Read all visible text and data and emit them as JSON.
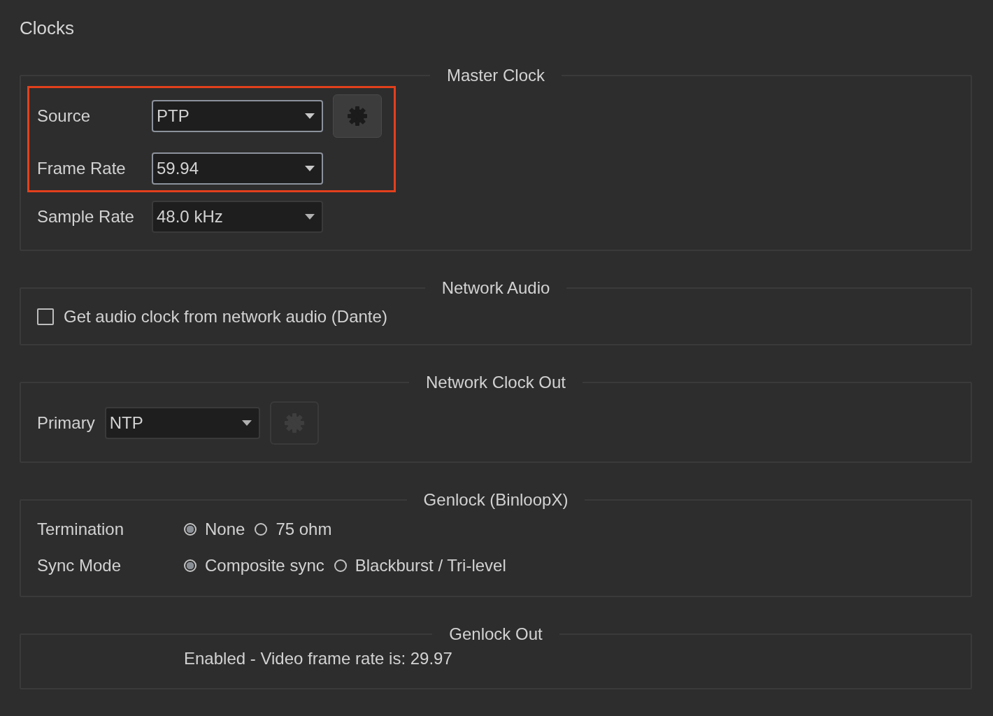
{
  "title": "Clocks",
  "sections": [
    {
      "legend": "Master Clock",
      "kind": "dropdowns",
      "rows": [
        {
          "label": "Source",
          "value": "PTP",
          "highlighted": true,
          "gear": {
            "disabled": false
          }
        },
        {
          "label": "Frame Rate",
          "value": "59.94",
          "highlighted": true
        },
        {
          "label": "Sample Rate",
          "value": "48.0 kHz",
          "highlighted": false
        }
      ]
    },
    {
      "legend": "Network Audio",
      "kind": "checkbox",
      "label": "Get audio clock from network audio (Dante)",
      "checked": false
    },
    {
      "legend": "Network Clock Out",
      "kind": "dropdowns",
      "rows": [
        {
          "label": "Primary",
          "value": "NTP",
          "highlighted": false,
          "gear": {
            "disabled": true
          }
        }
      ]
    },
    {
      "legend": "Genlock (BinloopX)",
      "kind": "radios",
      "groups": [
        {
          "label": "Termination",
          "options": [
            {
              "label": "None",
              "selected": true
            },
            {
              "label": "75 ohm",
              "selected": false
            }
          ]
        },
        {
          "label": "Sync Mode",
          "options": [
            {
              "label": "Composite sync",
              "selected": true
            },
            {
              "label": "Blackburst / Tri-level",
              "selected": false
            }
          ]
        }
      ]
    },
    {
      "legend": "Genlock Out",
      "kind": "status",
      "text": "Enabled - Video frame rate is: 29.97"
    }
  ]
}
